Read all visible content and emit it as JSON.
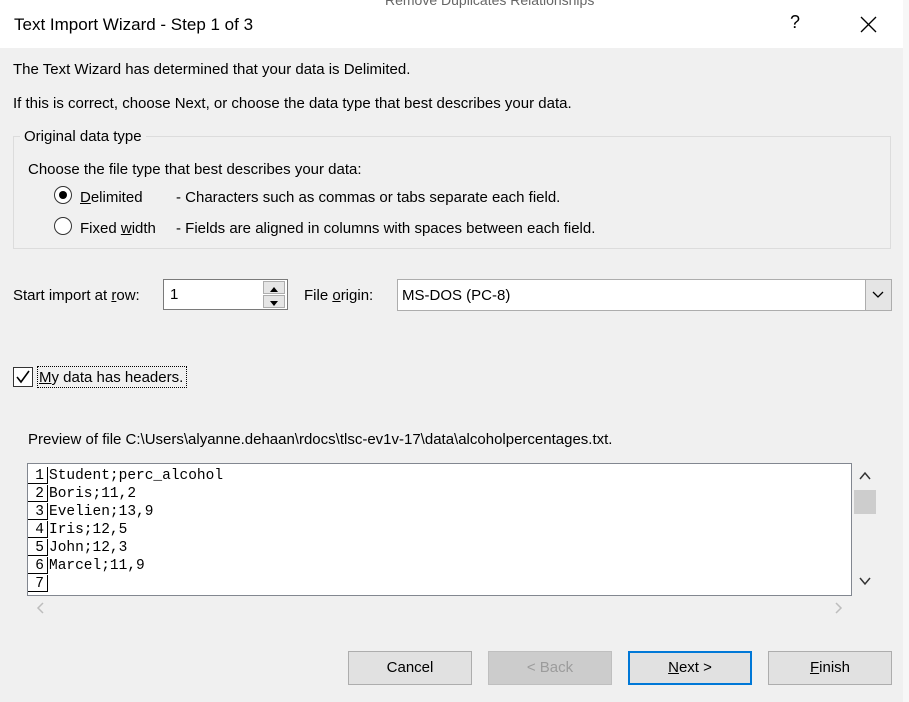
{
  "window": {
    "title": "Text Import Wizard - Step 1 of 3",
    "help_label": "?",
    "background_peek": "Remove Duplicates    Relationships"
  },
  "intro": {
    "line1": "The Text Wizard has determined that your data is Delimited.",
    "line2": "If this is correct, choose Next, or choose the data type that best describes your data."
  },
  "original_data_type": {
    "group_label": "Original data type",
    "prompt": "Choose the file type that best describes your data:",
    "options": [
      {
        "label_first": "D",
        "label_rest": "elimited",
        "description": "- Characters such as commas or tabs separate each field.",
        "selected": true
      },
      {
        "label_first": "Fixed ",
        "label_underlined": "w",
        "label_rest": "idth",
        "description": "- Fields are aligned in columns with spaces between each field.",
        "selected": false
      }
    ]
  },
  "start_row": {
    "label_pre": "Start import at ",
    "label_underlined": "r",
    "label_post": "ow:",
    "value": "1"
  },
  "file_origin": {
    "label_pre": "File ",
    "label_underlined": "o",
    "label_post": "rigin:",
    "value": "MS-DOS (PC-8)"
  },
  "headers_checkbox": {
    "label_underlined": "M",
    "label_rest": "y data has headers.",
    "checked": true
  },
  "preview": {
    "label": "Preview of file C:\\Users\\alyanne.dehaan\\rdocs\\tlsc-ev1v-17\\data\\alcoholpercentages.txt.",
    "rows": [
      {
        "num": "1",
        "text": "Student;perc_alcohol"
      },
      {
        "num": "2",
        "text": "Boris;11,2"
      },
      {
        "num": "3",
        "text": "Evelien;13,9"
      },
      {
        "num": "4",
        "text": "Iris;12,5"
      },
      {
        "num": "5",
        "text": "John;12,3"
      },
      {
        "num": "6",
        "text": "Marcel;11,9"
      },
      {
        "num": "7",
        "text": ""
      }
    ]
  },
  "buttons": {
    "cancel": "Cancel",
    "back": "< Back",
    "next_underlined": "N",
    "next_rest": "ext >",
    "finish_underlined": "F",
    "finish_rest": "inish"
  },
  "colors": {
    "accent": "#0078d7",
    "dialog_bg": "#f0f0f0"
  }
}
